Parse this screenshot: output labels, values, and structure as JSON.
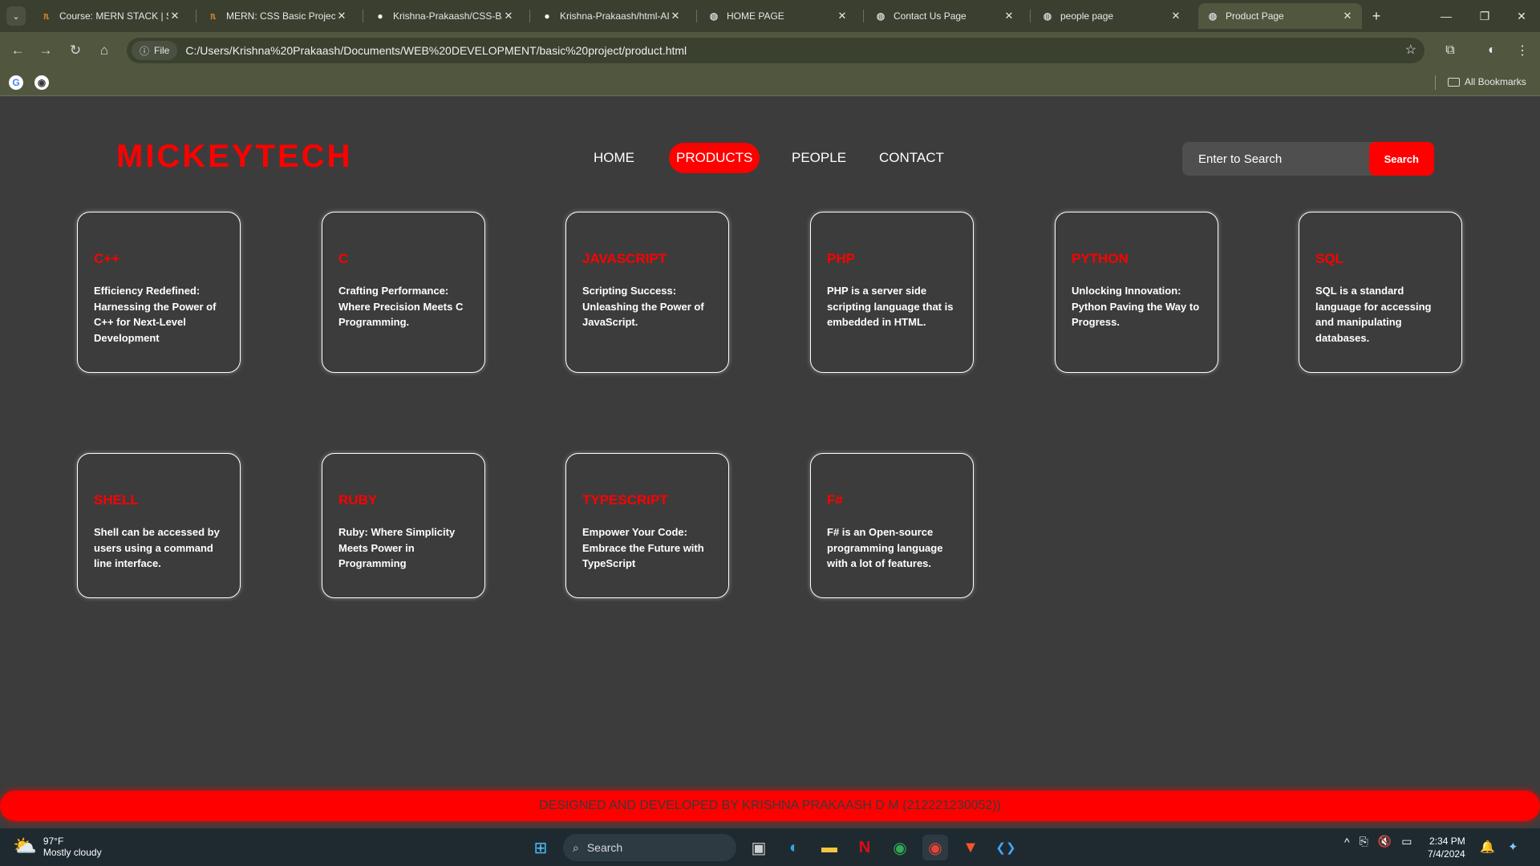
{
  "browser": {
    "tabs": [
      {
        "title": "Course: MERN STACK | SE",
        "icon": "udemy-icon",
        "glyph": "ᥰ",
        "color": "#f08a24",
        "active": false
      },
      {
        "title": "MERN: CSS Basic Project -",
        "icon": "udemy-icon",
        "glyph": "ᥰ",
        "color": "#f08a24",
        "active": false
      },
      {
        "title": "Krishna-Prakaash/CSS-BA",
        "icon": "github-icon",
        "glyph": "●",
        "color": "#ffffff",
        "active": false
      },
      {
        "title": "Krishna-Prakaash/html-AI",
        "icon": "github-icon",
        "glyph": "●",
        "color": "#ffffff",
        "active": false
      },
      {
        "title": "HOME PAGE",
        "icon": "globe-icon",
        "glyph": "◍",
        "color": "#cfcfcf",
        "active": false
      },
      {
        "title": "Contact Us Page",
        "icon": "globe-icon",
        "glyph": "◍",
        "color": "#cfcfcf",
        "active": false
      },
      {
        "title": "people page",
        "icon": "globe-icon",
        "glyph": "◍",
        "color": "#cfcfcf",
        "active": false
      },
      {
        "title": "Product Page",
        "icon": "globe-icon",
        "glyph": "◍",
        "color": "#cfcfcf",
        "active": true
      }
    ],
    "close_glyph": "✕",
    "new_tab_glyph": "+",
    "window": {
      "minimize": "—",
      "restore": "❐",
      "close": "✕"
    },
    "nav": {
      "back": "←",
      "forward": "→",
      "reload": "↻",
      "home": "⌂"
    },
    "omnibox": {
      "chip_icon": "ⓘ",
      "chip_label": "File",
      "url": "C:/Users/Krishna%20Prakaash/Documents/WEB%20DEVELOPMENT/basic%20project/product.html",
      "star": "☆"
    },
    "toolbar_right": {
      "extensions": "⧉",
      "profile": "◐",
      "menu": "⋮"
    },
    "bookmarks": {
      "items": [
        {
          "icon": "google-icon",
          "glyph": "G",
          "color": "#4285f4"
        },
        {
          "icon": "chrome-web-store-icon",
          "glyph": "◉",
          "color": "#3a3a3a"
        }
      ],
      "all_label": "All Bookmarks"
    }
  },
  "site": {
    "brand": "MICKEYTECH",
    "nav": [
      {
        "label": "HOME",
        "active": false
      },
      {
        "label": "PRODUCTS",
        "active": true
      },
      {
        "label": "PEOPLE",
        "active": false
      },
      {
        "label": "CONTACT",
        "active": false
      }
    ],
    "search": {
      "placeholder": "Enter to Search",
      "button": "Search"
    },
    "products": [
      {
        "title": "C++",
        "description": "Efficiency Redefined: Harnessing the Power of C++ for Next-Level Development"
      },
      {
        "title": "C",
        "description": "Crafting Performance: Where Precision Meets C Programming."
      },
      {
        "title": "JAVASCRIPT",
        "description": "Scripting Success: Unleashing the Power of JavaScript."
      },
      {
        "title": "PHP",
        "description": "PHP is a server side scripting language that is embedded in HTML."
      },
      {
        "title": "PYTHON",
        "description": "Unlocking Innovation: Python Paving the Way to Progress."
      },
      {
        "title": "SQL",
        "description": "SQL is a standard language for accessing and manipulating databases."
      },
      {
        "title": "SHELL",
        "description": "Shell can be accessed by users using a command line interface."
      },
      {
        "title": "RUBY",
        "description": "Ruby: Where Simplicity Meets Power in Programming"
      },
      {
        "title": "TYPESCRIPT",
        "description": "Empower Your Code: Embrace the Future with TypeScript"
      },
      {
        "title": "F#",
        "description": "F# is an Open-source programming language with a lot of features."
      }
    ],
    "footer": "DESIGNED AND DEVELOPED BY KRISHNA PRAKAASH D M (212221230052))"
  },
  "taskbar": {
    "weather": {
      "temp": "97°F",
      "condition": "Mostly cloudy",
      "icon": "partly-cloudy-icon"
    },
    "search_label": "Search",
    "apps": [
      {
        "name": "start-button",
        "glyph": "⊞",
        "color": "#4cc2ff"
      },
      {
        "name": "task-view-icon",
        "glyph": "▣",
        "color": "#d0d0d0"
      },
      {
        "name": "edge-icon",
        "glyph": "◐",
        "color": "#2fa8e8"
      },
      {
        "name": "file-explorer-icon",
        "glyph": "▬",
        "color": "#f4c542"
      },
      {
        "name": "netflix-icon",
        "glyph": "N",
        "color": "#e50914"
      },
      {
        "name": "chrome-icon",
        "glyph": "◉",
        "color": "#34a853"
      },
      {
        "name": "chrome-profile-icon",
        "glyph": "◉",
        "color": "#ea4335"
      },
      {
        "name": "brave-icon",
        "glyph": "▼",
        "color": "#fb542b"
      },
      {
        "name": "vscode-icon",
        "glyph": "❮❯",
        "color": "#3ea6ff"
      }
    ],
    "tray": {
      "chevron": "^",
      "network": "⎘",
      "volume": "🔇",
      "battery": "▭"
    },
    "clock": {
      "time": "2:34 PM",
      "date": "7/4/2024"
    },
    "notifications": "🔔",
    "copilot": "✦"
  }
}
